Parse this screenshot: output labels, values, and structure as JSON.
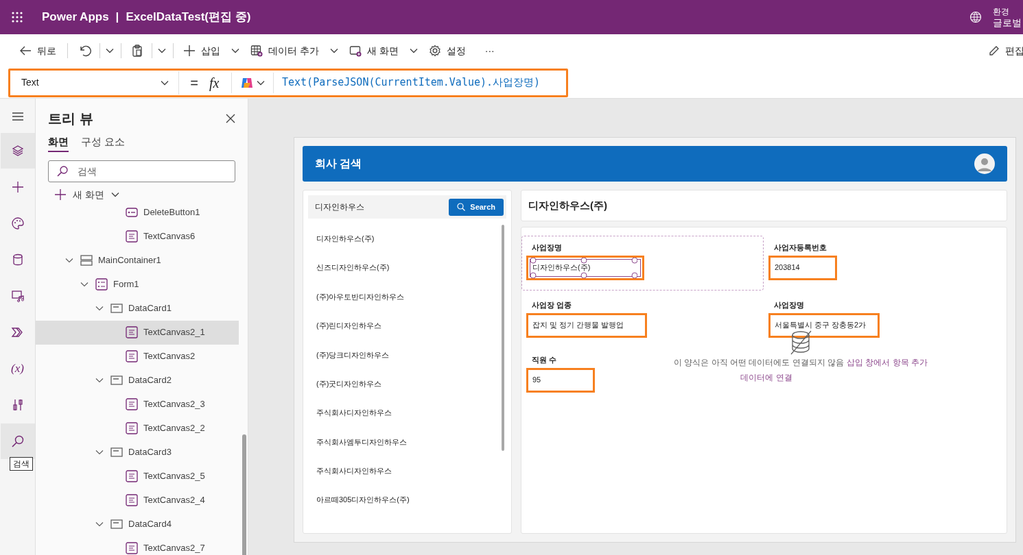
{
  "app_bar": {
    "title": "Power Apps",
    "separator": "|",
    "document": "ExcelDataTest(편집 중)",
    "environment_label": "환경",
    "environment_name": "글로벌"
  },
  "toolbar": {
    "items": [
      {
        "kind": "back",
        "label": "뒤로"
      },
      {
        "kind": "undo"
      },
      {
        "kind": "paste"
      },
      {
        "kind": "insert",
        "label": "삽입"
      },
      {
        "kind": "data",
        "label": "데이터 추가"
      },
      {
        "kind": "screen",
        "label": "새 화면"
      },
      {
        "kind": "settings",
        "label": "설정"
      },
      {
        "kind": "more",
        "label": "···"
      }
    ],
    "edit_label": "편집"
  },
  "formula_bar": {
    "property": "Text",
    "equals": "=",
    "fx": "fx",
    "formula": "Text(ParseJSON(CurrentItem.Value).사업장명)",
    "highlighted": true
  },
  "rail": {
    "items": [
      {
        "kind": "menu",
        "selected": false
      },
      {
        "kind": "layers",
        "selected": true
      },
      {
        "kind": "add",
        "selected": false
      },
      {
        "kind": "palette",
        "selected": false
      },
      {
        "kind": "database",
        "selected": false
      },
      {
        "kind": "media",
        "selected": false
      },
      {
        "kind": "flow",
        "selected": false
      },
      {
        "kind": "variables",
        "label": "(x)",
        "selected": false
      },
      {
        "kind": "tools",
        "selected": false
      },
      {
        "kind": "search",
        "selected": true
      }
    ],
    "tooltip": "검색"
  },
  "tree": {
    "title": "트리 뷰",
    "tabs": [
      {
        "label": "화면",
        "selected": true
      },
      {
        "label": "구성 요소",
        "selected": false
      }
    ],
    "search": {
      "placeholder": "검색"
    },
    "new_screen": "새 화면",
    "items": [
      {
        "label": "DeleteButton1",
        "kind": "button",
        "selected": false
      },
      {
        "label": "TextCanvas6",
        "kind": "text",
        "selected": false
      },
      {
        "label": "MainContainer1",
        "kind": "container",
        "selected": false,
        "expanded": true,
        "children": [
          {
            "label": "Form1",
            "kind": "form",
            "selected": false,
            "expanded": true,
            "children": [
              {
                "label": "DataCard1",
                "kind": "card",
                "selected": false,
                "expanded": true,
                "children": [
                  {
                    "label": "TextCanvas2_1",
                    "kind": "text",
                    "selected": true
                  },
                  {
                    "label": "TextCanvas2",
                    "kind": "text",
                    "selected": false
                  }
                ]
              },
              {
                "label": "DataCard2",
                "kind": "card",
                "selected": false,
                "expanded": true,
                "children": [
                  {
                    "label": "TextCanvas2_3",
                    "kind": "text",
                    "selected": false
                  },
                  {
                    "label": "TextCanvas2_2",
                    "kind": "text",
                    "selected": false
                  }
                ]
              },
              {
                "label": "DataCard3",
                "kind": "card",
                "selected": false,
                "expanded": true,
                "children": [
                  {
                    "label": "TextCanvas2_5",
                    "kind": "text",
                    "selected": false
                  },
                  {
                    "label": "TextCanvas2_4",
                    "kind": "text",
                    "selected": false
                  }
                ]
              },
              {
                "label": "DataCard4",
                "kind": "card",
                "selected": false,
                "expanded": true,
                "children": [
                  {
                    "label": "TextCanvas2_7",
                    "kind": "text",
                    "selected": false
                  }
                ]
              }
            ]
          }
        ]
      }
    ]
  },
  "app": {
    "header": {
      "title": "회사 검색"
    },
    "search": {
      "value": "디자인하우스",
      "button": "Search"
    },
    "results": [
      {
        "label": "디자인하우스(주)"
      },
      {
        "label": "신즈디자인하우스(주)"
      },
      {
        "label": "(주)아우토반디자인하우스"
      },
      {
        "label": "(주)린디자인하우스"
      },
      {
        "label": "(주)당크디자인하우스"
      },
      {
        "label": "(주)굿디자인하우스"
      },
      {
        "label": "주식회사디자인하우스"
      },
      {
        "label": "주식회사엠투디자인하우스"
      },
      {
        "label": "주식회사디자인하우스"
      },
      {
        "label": "아르떼305디자인하우스(주)"
      }
    ],
    "detail_title": "디자인하우스(주)",
    "fields": [
      {
        "label": "사업장명",
        "value": "디자인하우스(주)",
        "highlighted": true,
        "selected": true
      },
      {
        "label": "사업자등록번호",
        "value": "203814",
        "highlighted": true,
        "selected": false
      },
      {
        "label": "사업장 업종",
        "value": "잡지 및 정기 간행물 발행업",
        "highlighted": true,
        "selected": false
      },
      {
        "label": "사업장명",
        "value": "서울특별시 중구 장충동2가",
        "highlighted": true,
        "selected": false
      },
      {
        "label": "직원 수",
        "value": "95",
        "highlighted": true,
        "selected": false
      }
    ],
    "empty_state": {
      "message": "이 양식은 아직 어떤 데이터에도 연결되지 않음",
      "hint": "삽입 창에서 항목 추가",
      "link": "데이터에 연결"
    }
  }
}
